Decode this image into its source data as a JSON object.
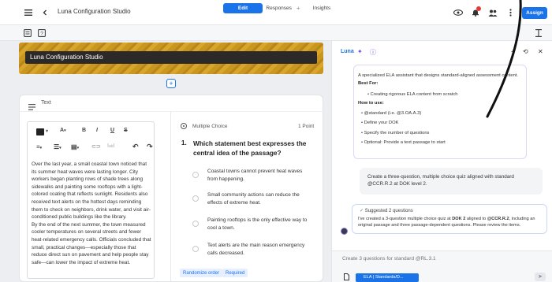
{
  "app": {
    "title": "Luna Configuration Studio",
    "assign_label": "Assign"
  },
  "tabs": [
    {
      "label": "Edit"
    },
    {
      "label": "Responses"
    },
    {
      "label": "Insights"
    }
  ],
  "banner": {
    "title": "Luna Configuration Studio"
  },
  "text_card": {
    "header": "Text",
    "paragraph": "Over the last year, a small coastal town noticed that its summer heat waves were lasting longer. City workers began planting rows of shade trees along sidewalks and painting some rooftops with a light-colored coating that reflects sunlight. Residents also received text alerts on the hottest days reminding them to check on neighbors, drink water, and visit air-conditioned public buildings like the library.",
    "paragraph2": "By the end of the next summer, the town measured cooler temperatures on several streets and fewer heat-related emergency calls. Officials concluded that small, practical changes—especially those that reduce direct sun on pavement and help people stay safe—can lower the impact of extreme heat."
  },
  "question": {
    "type": "Multiple Choice",
    "points": "1 Point",
    "number": "1.",
    "text": "Which statement best expresses the central idea of the passage?",
    "options": [
      "Coastal towns cannot prevent heat waves from happening.",
      "Small community actions can reduce the effects of extreme heat.",
      "Painting rooftops is the only effective way to cool a town.",
      "Text alerts are the main reason emergency calls decreased."
    ],
    "tags": [
      "Randomize order",
      "Required"
    ]
  },
  "assistant": {
    "name": "Luna",
    "intro": "A specialized ELA assistant that designs standard-aligned assessment content.",
    "best_for_label": "Best For:",
    "best_for": [
      "Creating rigorous ELA content from scratch"
    ],
    "how_to_label": "How to use:",
    "how_to": [
      "@standard (i.e. @3.OA.A.3)",
      "Define your DOK",
      "Specify the number of questions",
      "Optional: Provide a text passage to start"
    ],
    "user_message": "Create a three-question, multiple choice quiz aligned with standard @CCR.R.2 at DOK level 2.",
    "status": "Suggested 2 questions",
    "reply_pre": "I've created a 3-question multiple choice quiz at ",
    "reply_dok": "DOK 2",
    "reply_mid": " aligned to ",
    "reply_std": "@CCR.R.2",
    "reply_post": ", including an original passage and three passage-dependent questions. Please review the items.",
    "input_placeholder": "Create 3 questions for standard @RL.3.1",
    "chip_label": "ELA | Standards/D..."
  }
}
